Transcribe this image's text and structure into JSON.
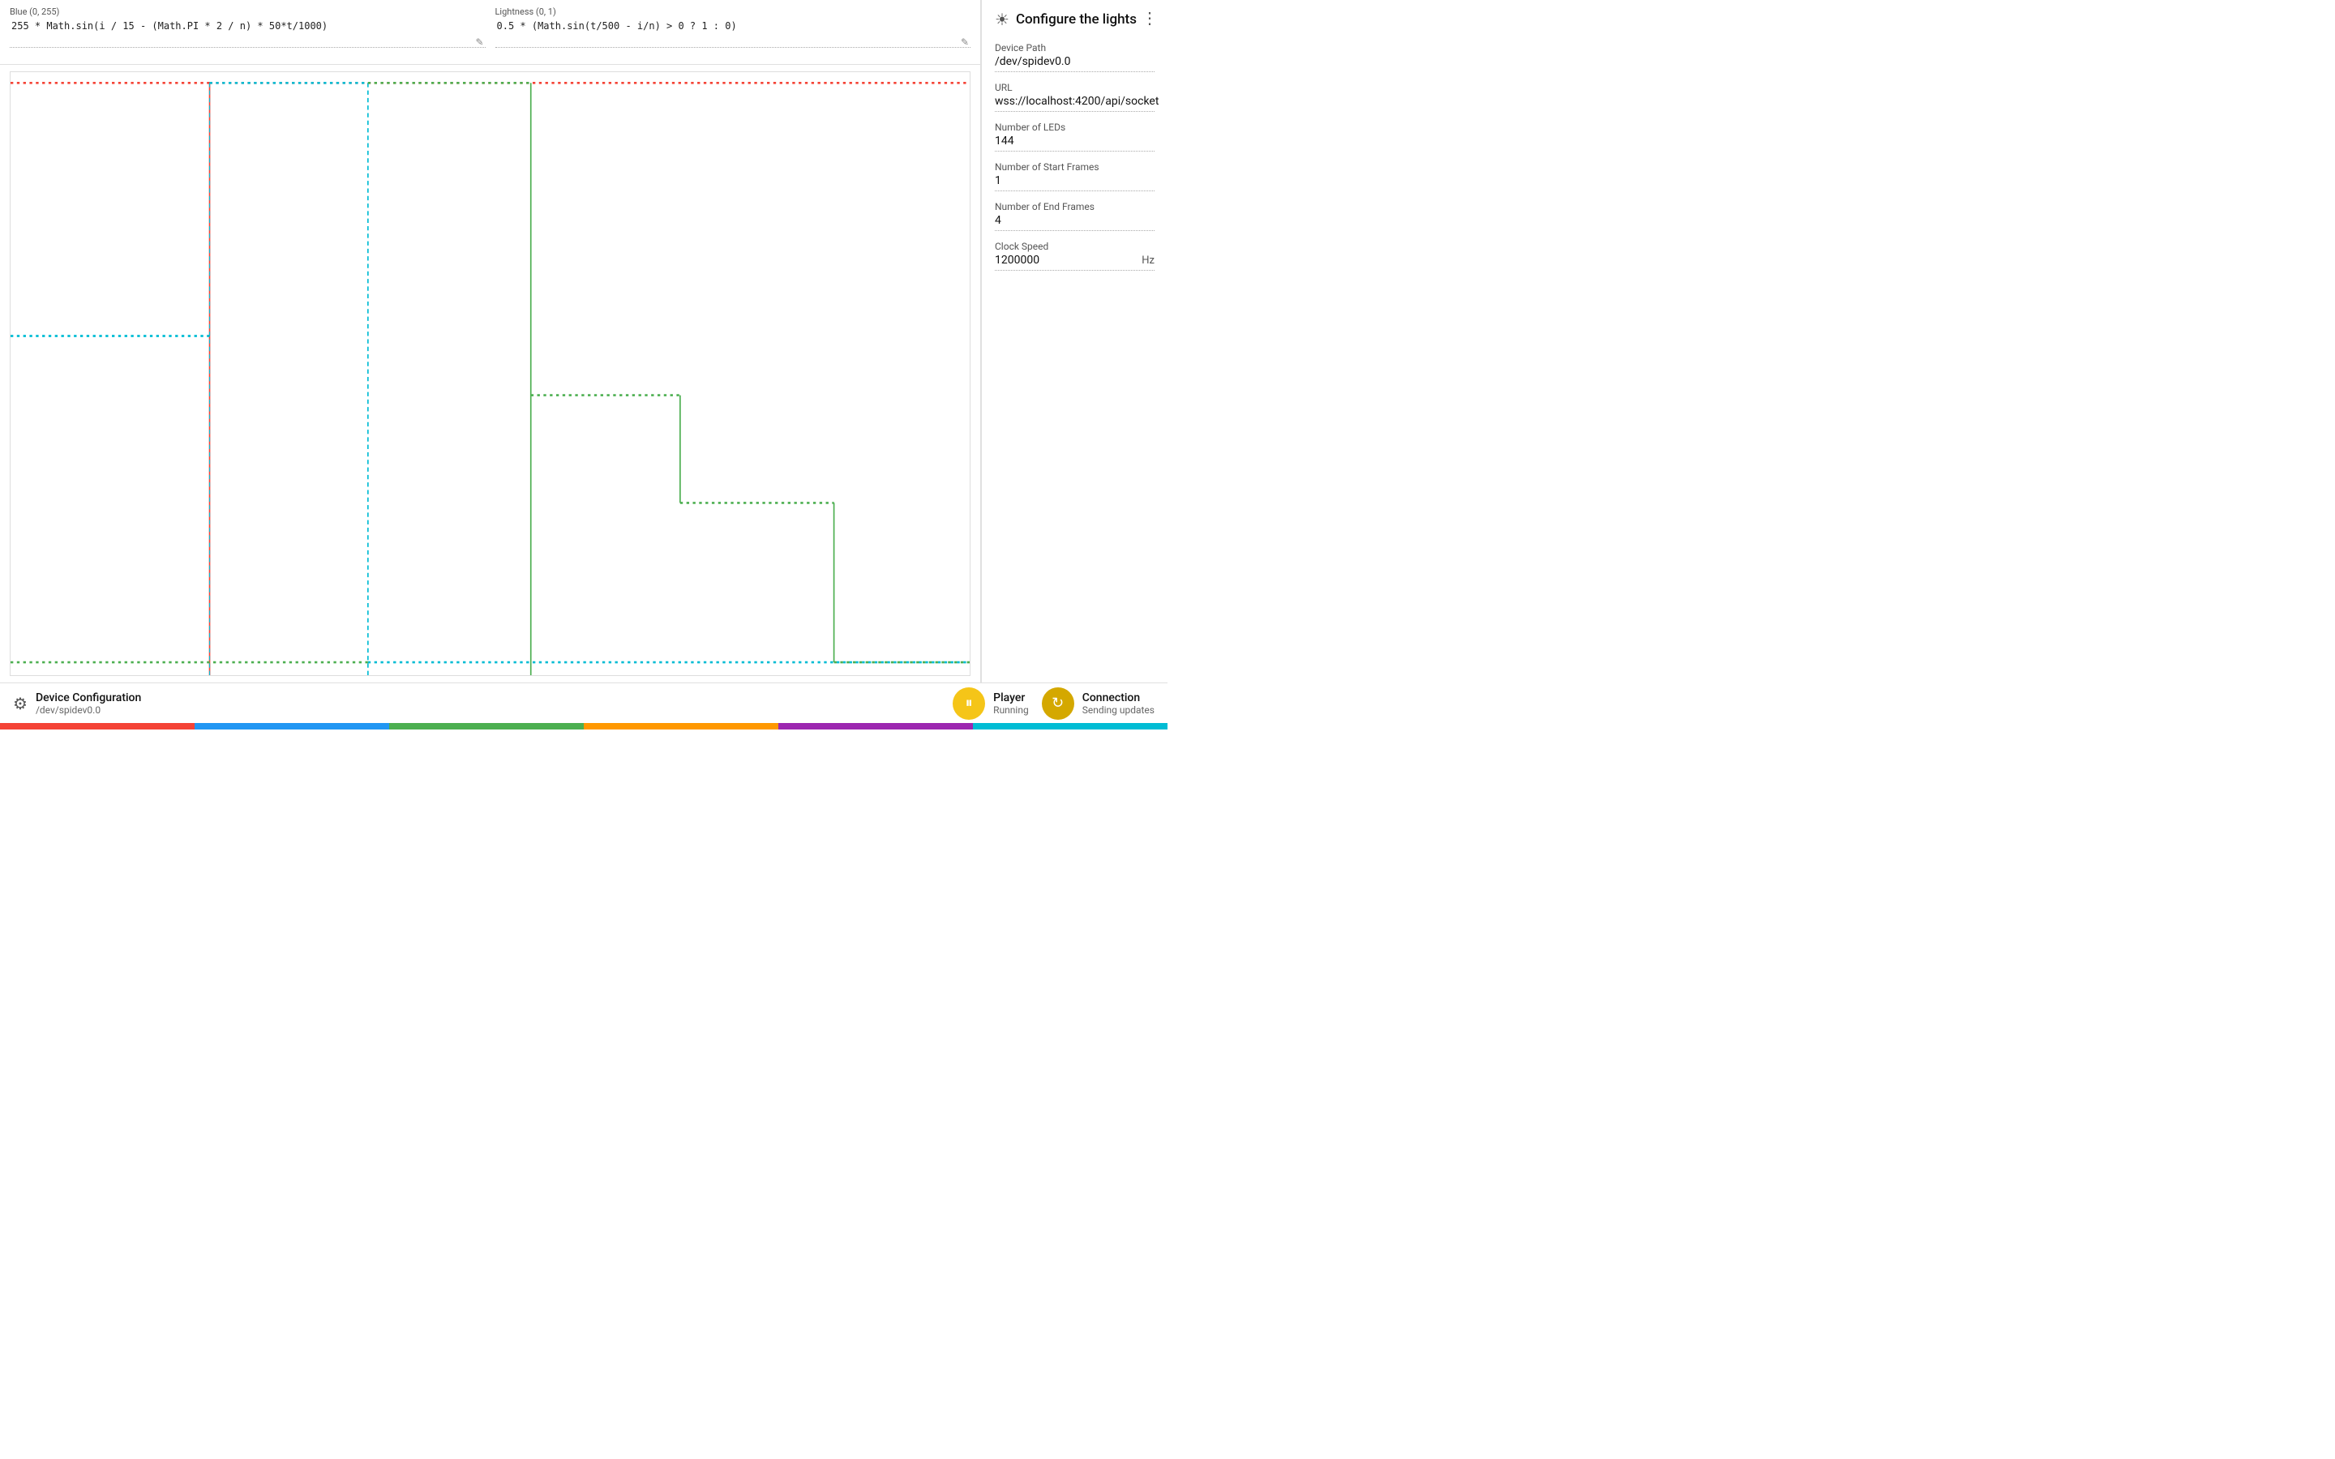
{
  "menu": {
    "dots_label": "⋮"
  },
  "sidebar": {
    "title": "Configure the lights",
    "device_path_label": "Device Path",
    "device_path_value": "/dev/spidev0.0",
    "url_label": "URL",
    "url_value": "wss://localhost:4200/api/socket",
    "num_leds_label": "Number of LEDs",
    "num_leds_value": "144",
    "num_start_frames_label": "Number of Start Frames",
    "num_start_frames_value": "1",
    "num_end_frames_label": "Number of End Frames",
    "num_end_frames_value": "4",
    "clock_speed_label": "Clock Speed",
    "clock_speed_value": "1200000",
    "clock_speed_unit": "Hz"
  },
  "editors": {
    "row1": {
      "left": {
        "label": "Blue (0, 255)",
        "value": "255 * Math.sin(i / 15 - (Math.PI * 2 / n) * 50*t/1000)"
      },
      "right": {
        "label": "Lightness (0, 1)",
        "value": "0.5 * (Math.sin(t/500 - i/n) > 0 ? 1 : 0)"
      }
    }
  },
  "status_bar": {
    "device_name": "Device Configuration",
    "device_path": "/dev/spidev0.0",
    "player_label": "Player",
    "player_status": "Running",
    "connection_label": "Connection",
    "connection_status": "Sending updates"
  },
  "color_bar": {
    "colors": [
      "#f44336",
      "#2196f3",
      "#4caf50",
      "#ff9800",
      "#9c27b0",
      "#00bcd4"
    ]
  }
}
